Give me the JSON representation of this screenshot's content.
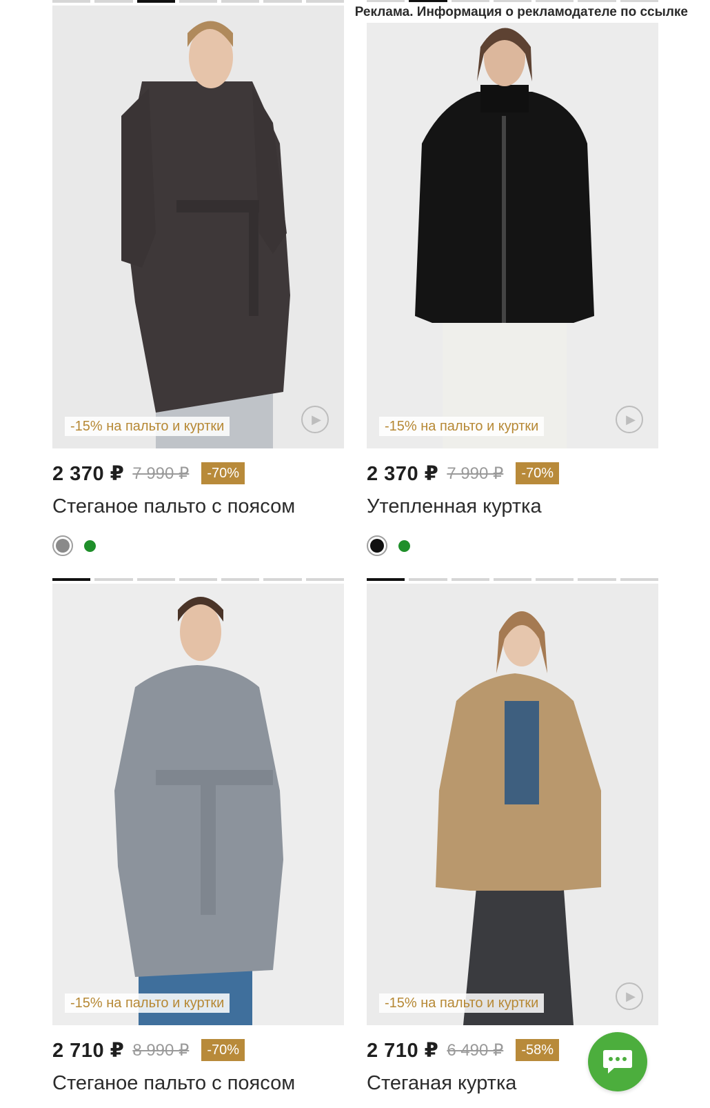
{
  "ad_disclaimer": "Реклама. Информация о рекламодателе по ссылке",
  "colors": {
    "accent_gold": "#b88a3a",
    "chat_green": "#4cae3d"
  },
  "products": [
    {
      "promo": "-15% на пальто и куртки",
      "price": "2 370 ₽",
      "old_price": "7 990 ₽",
      "discount": "-70%",
      "title": "Стеганое пальто с поясом",
      "selected_color": "#8a8a8a",
      "other_color": "#1f8f2a",
      "image_icon": "play-icon"
    },
    {
      "promo": "-15% на пальто и куртки",
      "price": "2 370 ₽",
      "old_price": "7 990 ₽",
      "discount": "-70%",
      "title": "Утепленная куртка",
      "selected_color": "#111111",
      "other_color": "#1f8f2a",
      "image_icon": "play-icon"
    },
    {
      "promo": "-15% на пальто и куртки",
      "price": "2 710 ₽",
      "old_price": "8 990 ₽",
      "discount": "-70%",
      "title": "Стеганое пальто с поясом"
    },
    {
      "promo": "-15% на пальто и куртки",
      "price": "2 710 ₽",
      "old_price": "6 490 ₽",
      "discount": "-58%",
      "title": "Стеганая куртка",
      "image_icon": "play-icon"
    }
  ],
  "chat_icon": "chat-bubble-icon"
}
